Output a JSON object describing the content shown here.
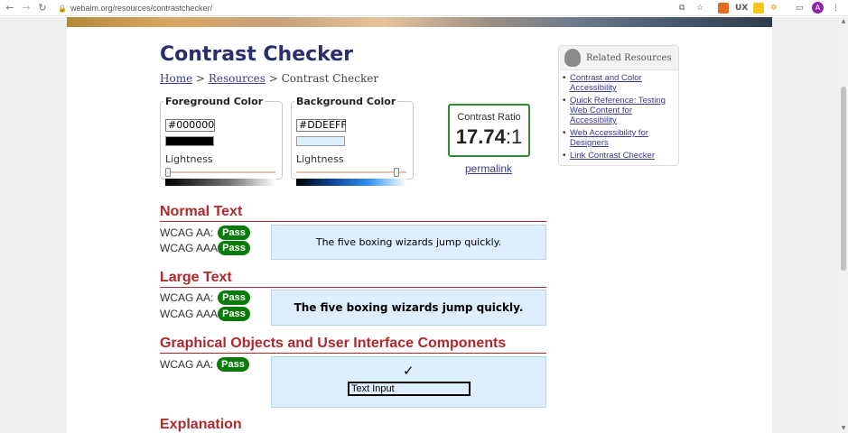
{
  "browser": {
    "url": "webaim.org/resources/contrastchecker/",
    "avatar_letter": "A"
  },
  "page": {
    "title": "Contrast Checker",
    "breadcrumb": {
      "home": "Home",
      "sep1": ">",
      "resources": "Resources",
      "sep2": ">",
      "current": "Contrast Checker"
    }
  },
  "foreground": {
    "legend": "Foreground Color",
    "hex": "#000000",
    "lightness_label": "Lightness",
    "swatch_color": "#000000",
    "lightness_value": 0.0
  },
  "background": {
    "legend": "Background Color",
    "hex": "#DDEEFF",
    "lightness_label": "Lightness",
    "swatch_color": "#DDEEFF",
    "lightness_value": 0.93
  },
  "ratio": {
    "label": "Contrast Ratio",
    "value": "17.74",
    "suffix": ":1",
    "permalink": "permalink"
  },
  "normal_text": {
    "heading": "Normal Text",
    "aa_label": "WCAG AA:",
    "aa_result": "Pass",
    "aaa_label": "WCAG AAA:",
    "aaa_result": "Pass",
    "sample": "The five boxing wizards jump quickly."
  },
  "large_text": {
    "heading": "Large Text",
    "aa_label": "WCAG AA:",
    "aa_result": "Pass",
    "aaa_label": "WCAG AAA:",
    "aaa_result": "Pass",
    "sample": "The five boxing wizards jump quickly."
  },
  "graphical": {
    "heading": "Graphical Objects and User Interface Components",
    "aa_label": "WCAG AA:",
    "aa_result": "Pass",
    "checkmark": "✓",
    "input_sample": "Text Input"
  },
  "explanation": {
    "heading": "Explanation"
  },
  "related": {
    "title": "Related Resources",
    "links": [
      "Contrast and Color Accessibility",
      "Quick Reference: Testing Web Content for Accessibility",
      "Web Accessibility for Designers",
      "Link Contrast Checker"
    ]
  },
  "colors": {
    "pass_green": "#0A7A0A",
    "heading_red": "#B0282C",
    "title_navy": "#2A2F6B",
    "link_blue": "#3B3B8F"
  }
}
